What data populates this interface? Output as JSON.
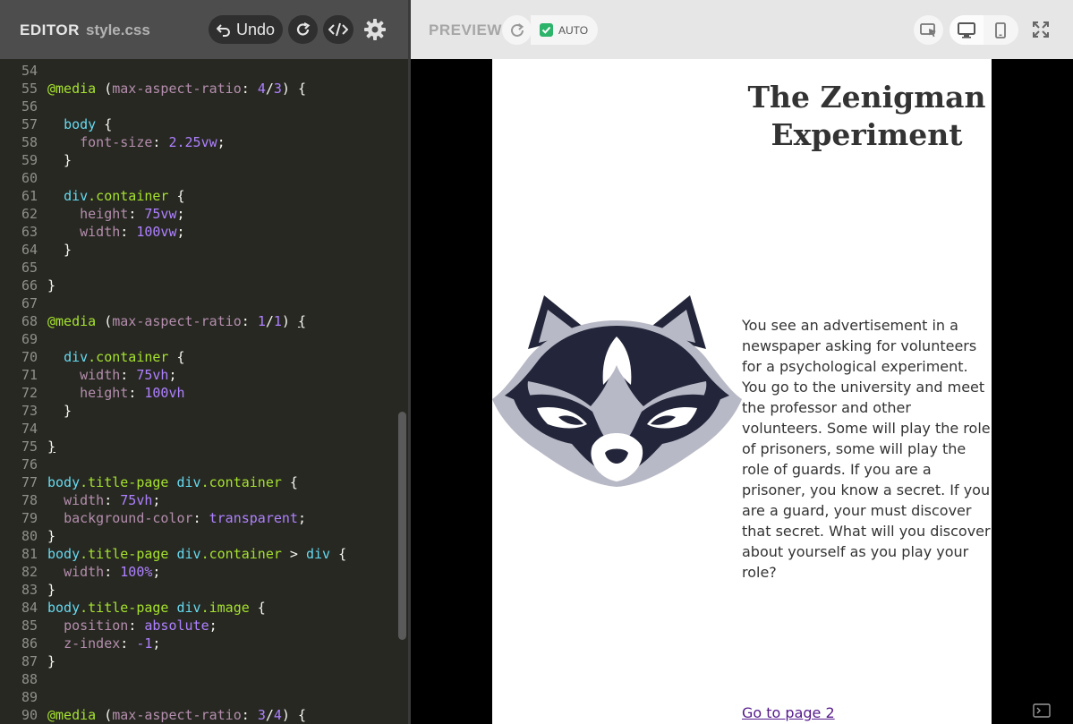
{
  "editor": {
    "title": "EDITOR",
    "file": "style.css",
    "undo_label": "Undo",
    "icons": [
      "undo-icon",
      "redo-icon",
      "code-icon",
      "gear-icon"
    ],
    "lines": [
      {
        "n": "54",
        "tokens": [
          [
            "",
            ""
          ]
        ]
      },
      {
        "n": "55",
        "tokens": [
          [
            "t-media",
            "@media"
          ],
          [
            "",
            " ("
          ],
          [
            "t-feat",
            "max-aspect-ratio"
          ],
          [
            "",
            ": "
          ],
          [
            "t-num",
            "4"
          ],
          [
            "",
            "/"
          ],
          [
            "t-num",
            "3"
          ],
          [
            "",
            ") {"
          ]
        ]
      },
      {
        "n": "56",
        "tokens": [
          [
            "",
            ""
          ]
        ]
      },
      {
        "n": "57",
        "tokens": [
          [
            "",
            "  "
          ],
          [
            "t-sel",
            "body"
          ],
          [
            "",
            " {"
          ]
        ]
      },
      {
        "n": "58",
        "tokens": [
          [
            "",
            "    "
          ],
          [
            "t-feat",
            "font-size"
          ],
          [
            "",
            ": "
          ],
          [
            "t-num",
            "2.25vw"
          ],
          [
            "",
            ";"
          ]
        ]
      },
      {
        "n": "59",
        "tokens": [
          [
            "",
            "  }"
          ]
        ]
      },
      {
        "n": "60",
        "tokens": [
          [
            "",
            ""
          ]
        ]
      },
      {
        "n": "61",
        "tokens": [
          [
            "",
            "  "
          ],
          [
            "t-sel",
            "div"
          ],
          [
            "t-cls",
            ".container"
          ],
          [
            "",
            " {"
          ]
        ]
      },
      {
        "n": "62",
        "tokens": [
          [
            "",
            "    "
          ],
          [
            "t-feat",
            "height"
          ],
          [
            "",
            ": "
          ],
          [
            "t-num",
            "75vw"
          ],
          [
            "",
            ";"
          ]
        ]
      },
      {
        "n": "63",
        "tokens": [
          [
            "",
            "    "
          ],
          [
            "t-feat",
            "width"
          ],
          [
            "",
            ": "
          ],
          [
            "t-num",
            "100vw"
          ],
          [
            "",
            ";"
          ]
        ]
      },
      {
        "n": "64",
        "tokens": [
          [
            "",
            "  }"
          ]
        ]
      },
      {
        "n": "65",
        "tokens": [
          [
            "",
            ""
          ]
        ]
      },
      {
        "n": "66",
        "tokens": [
          [
            "",
            "}"
          ]
        ]
      },
      {
        "n": "67",
        "tokens": [
          [
            "",
            ""
          ]
        ]
      },
      {
        "n": "68",
        "tokens": [
          [
            "t-media",
            "@media"
          ],
          [
            "",
            " ("
          ],
          [
            "t-feat",
            "max-aspect-ratio"
          ],
          [
            "",
            ": "
          ],
          [
            "t-num",
            "1"
          ],
          [
            "",
            "/"
          ],
          [
            "t-num",
            "1"
          ],
          [
            "",
            ") "
          ],
          [
            "uline",
            "{"
          ]
        ]
      },
      {
        "n": "69",
        "tokens": [
          [
            "",
            ""
          ]
        ]
      },
      {
        "n": "70",
        "tokens": [
          [
            "",
            "  "
          ],
          [
            "t-sel",
            "div"
          ],
          [
            "t-cls",
            ".container"
          ],
          [
            "",
            " {"
          ]
        ]
      },
      {
        "n": "71",
        "tokens": [
          [
            "",
            "    "
          ],
          [
            "t-feat",
            "width"
          ],
          [
            "",
            ": "
          ],
          [
            "t-num",
            "75vh"
          ],
          [
            "",
            ";"
          ]
        ]
      },
      {
        "n": "72",
        "tokens": [
          [
            "",
            "    "
          ],
          [
            "t-feat",
            "height"
          ],
          [
            "",
            ": "
          ],
          [
            "t-num",
            "100vh"
          ]
        ]
      },
      {
        "n": "73",
        "tokens": [
          [
            "",
            "  }"
          ]
        ]
      },
      {
        "n": "74",
        "tokens": [
          [
            "",
            ""
          ]
        ]
      },
      {
        "n": "75",
        "tokens": [
          [
            "uline",
            "}"
          ]
        ]
      },
      {
        "n": "76",
        "tokens": [
          [
            "",
            ""
          ]
        ]
      },
      {
        "n": "77",
        "tokens": [
          [
            "t-sel",
            "body"
          ],
          [
            "t-cls",
            ".title-page"
          ],
          [
            "",
            " "
          ],
          [
            "t-sel",
            "div"
          ],
          [
            "t-cls",
            ".container"
          ],
          [
            "",
            " {"
          ]
        ]
      },
      {
        "n": "78",
        "tokens": [
          [
            "",
            "  "
          ],
          [
            "t-feat",
            "width"
          ],
          [
            "",
            ": "
          ],
          [
            "t-num",
            "75vh"
          ],
          [
            "",
            ";"
          ]
        ]
      },
      {
        "n": "79",
        "tokens": [
          [
            "",
            "  "
          ],
          [
            "t-feat",
            "background-color"
          ],
          [
            "",
            ": "
          ],
          [
            "t-num",
            "transparent"
          ],
          [
            "",
            ";"
          ]
        ]
      },
      {
        "n": "80",
        "tokens": [
          [
            "",
            "}"
          ]
        ]
      },
      {
        "n": "81",
        "tokens": [
          [
            "t-sel",
            "body"
          ],
          [
            "t-cls",
            ".title-page"
          ],
          [
            "",
            " "
          ],
          [
            "t-sel",
            "div"
          ],
          [
            "t-cls",
            ".container"
          ],
          [
            "",
            " > "
          ],
          [
            "t-sel",
            "div"
          ],
          [
            "",
            " {"
          ]
        ]
      },
      {
        "n": "82",
        "tokens": [
          [
            "",
            "  "
          ],
          [
            "t-feat",
            "width"
          ],
          [
            "",
            ": "
          ],
          [
            "t-num",
            "100%"
          ],
          [
            "",
            ";"
          ]
        ]
      },
      {
        "n": "83",
        "tokens": [
          [
            "",
            "}"
          ]
        ]
      },
      {
        "n": "84",
        "tokens": [
          [
            "t-sel",
            "body"
          ],
          [
            "t-cls",
            ".title-page"
          ],
          [
            "",
            " "
          ],
          [
            "t-sel",
            "div"
          ],
          [
            "t-cls",
            ".image"
          ],
          [
            "",
            " {"
          ]
        ]
      },
      {
        "n": "85",
        "tokens": [
          [
            "",
            "  "
          ],
          [
            "t-feat",
            "position"
          ],
          [
            "",
            ": "
          ],
          [
            "t-num",
            "absolute"
          ],
          [
            "",
            ";"
          ]
        ]
      },
      {
        "n": "86",
        "tokens": [
          [
            "",
            "  "
          ],
          [
            "t-feat",
            "z-index"
          ],
          [
            "",
            ": "
          ],
          [
            "t-num",
            "-1"
          ],
          [
            "",
            ";"
          ]
        ]
      },
      {
        "n": "87",
        "tokens": [
          [
            "",
            "}"
          ]
        ]
      },
      {
        "n": "88",
        "tokens": [
          [
            "",
            ""
          ]
        ]
      },
      {
        "n": "89",
        "tokens": [
          [
            "",
            ""
          ]
        ]
      },
      {
        "n": "90",
        "tokens": [
          [
            "t-media",
            "@media"
          ],
          [
            "",
            " ("
          ],
          [
            "t-feat",
            "max-aspect-ratio"
          ],
          [
            "",
            ": "
          ],
          [
            "t-num",
            "3"
          ],
          [
            "",
            "/"
          ],
          [
            "t-num",
            "4"
          ],
          [
            "",
            ") {"
          ]
        ]
      }
    ]
  },
  "preview": {
    "title": "PREVIEW",
    "auto_label": "AUTO",
    "auto_checked": true,
    "icons": [
      "refresh-icon",
      "check-icon",
      "inspect-icon",
      "desktop-icon",
      "mobile-icon",
      "fullscreen-icon",
      "console-icon"
    ],
    "page": {
      "title": "The Zenigman Experiment",
      "story": "You see an advertisement in a newspaper asking for volunteers for a psychological experiment. You go to the university and meet the professor and other volunteers. Some will play the role of prisoners, some will play the role of guards. If you are a prisoner, you know a secret. If you are a guard, your must discover that secret. What will you discover about yourself as you play your role?",
      "link": "Go to page 2",
      "image": "raccoon-logo"
    }
  },
  "colors": {
    "editor_bg": "#272822",
    "editor_header": "#4d4d4d",
    "preview_header": "#e6e6e6",
    "check_green": "#2db36a",
    "raccoon_dark": "#23263a",
    "raccoon_grey": "#b8b9c6"
  }
}
